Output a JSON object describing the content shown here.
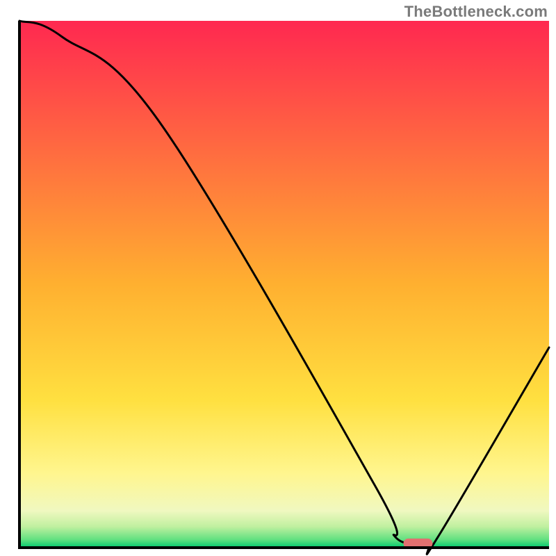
{
  "watermark": "TheBottleneck.com",
  "chart_data": {
    "type": "line",
    "title": "",
    "xlabel": "",
    "ylabel": "",
    "xlim": [
      0,
      100
    ],
    "ylim": [
      0,
      100
    ],
    "grid": false,
    "legend": false,
    "gradient_stops": [
      {
        "offset": 0.0,
        "color": "#ff2850"
      },
      {
        "offset": 0.5,
        "color": "#ffb030"
      },
      {
        "offset": 0.72,
        "color": "#ffe040"
      },
      {
        "offset": 0.86,
        "color": "#fff68f"
      },
      {
        "offset": 0.93,
        "color": "#f0f8c0"
      },
      {
        "offset": 0.96,
        "color": "#c0f0a0"
      },
      {
        "offset": 0.985,
        "color": "#60e080"
      },
      {
        "offset": 1.0,
        "color": "#00c86e"
      }
    ],
    "series": [
      {
        "name": "bottleneck-curve",
        "x": [
          0,
          8,
          27,
          67,
          71,
          77,
          79,
          100
        ],
        "values": [
          100,
          97,
          80,
          12,
          2,
          1,
          2,
          38
        ]
      }
    ],
    "marker": {
      "name": "optimal-point",
      "x_start": 72.5,
      "x_end": 78.0,
      "y": 0.8,
      "color": "#e27070"
    },
    "axis": {
      "color": "#000000",
      "width": 2
    }
  }
}
